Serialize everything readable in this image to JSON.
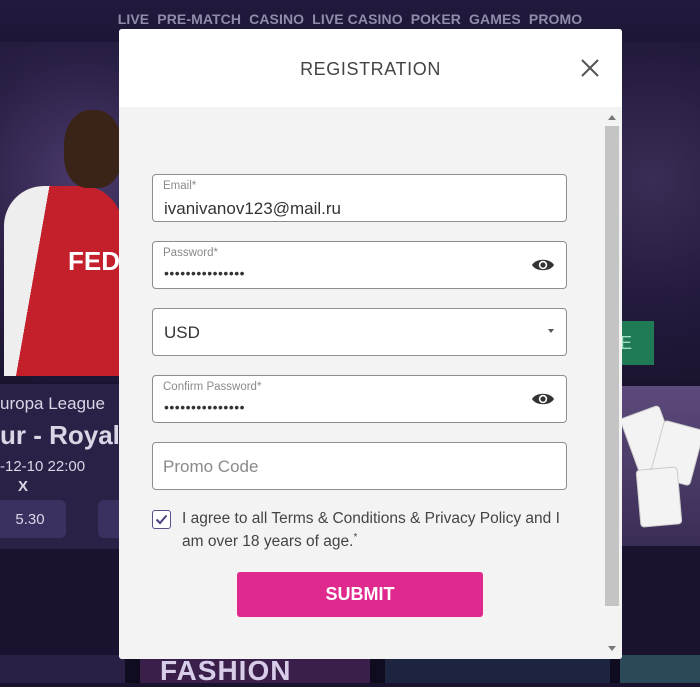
{
  "nav": {
    "items": [
      "LIVE",
      "PRE-MATCH",
      "CASINO",
      "LIVE CASINO",
      "POKER",
      "GAMES",
      "PROMO"
    ]
  },
  "background": {
    "player_shirt_text": "FEDCO",
    "event": {
      "league": "uropa League",
      "teams": "ur - Royal A",
      "date": "-12-10 22:00",
      "draw_label": "X",
      "odds": "5.30"
    },
    "right_button_label": "E",
    "bottom_banner_text": "FASHION"
  },
  "modal": {
    "title": "REGISTRATION",
    "email": {
      "label": "Email*",
      "value": "ivanivanov123@mail.ru"
    },
    "password": {
      "label": "Password*",
      "value": "•••••••••••••••"
    },
    "currency": {
      "value": "USD"
    },
    "confirm_password": {
      "label": "Confirm Password*",
      "value": "•••••••••••••••"
    },
    "promo_code": {
      "placeholder": "Promo Code"
    },
    "terms": {
      "checked": true,
      "text": "I agree to all Terms & Conditions & Privacy Policy and I am over 18 years of age.",
      "asterisk": "*"
    },
    "submit_label": "SUBMIT"
  },
  "colors": {
    "accent": "#e0298e",
    "nav_bg": "#1d1636",
    "checkbox_border": "#5a4f8a"
  }
}
